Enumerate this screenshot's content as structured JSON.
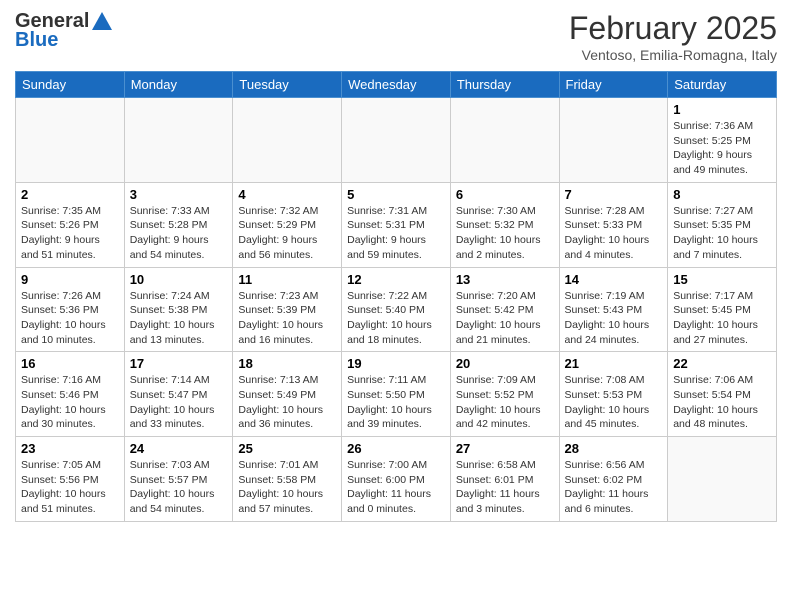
{
  "header": {
    "logo_general": "General",
    "logo_blue": "Blue",
    "month_title": "February 2025",
    "location": "Ventoso, Emilia-Romagna, Italy"
  },
  "days_of_week": [
    "Sunday",
    "Monday",
    "Tuesday",
    "Wednesday",
    "Thursday",
    "Friday",
    "Saturday"
  ],
  "weeks": [
    {
      "days": [
        {
          "num": "",
          "info": ""
        },
        {
          "num": "",
          "info": ""
        },
        {
          "num": "",
          "info": ""
        },
        {
          "num": "",
          "info": ""
        },
        {
          "num": "",
          "info": ""
        },
        {
          "num": "",
          "info": ""
        },
        {
          "num": "1",
          "info": "Sunrise: 7:36 AM\nSunset: 5:25 PM\nDaylight: 9 hours and 49 minutes."
        }
      ]
    },
    {
      "days": [
        {
          "num": "2",
          "info": "Sunrise: 7:35 AM\nSunset: 5:26 PM\nDaylight: 9 hours and 51 minutes."
        },
        {
          "num": "3",
          "info": "Sunrise: 7:33 AM\nSunset: 5:28 PM\nDaylight: 9 hours and 54 minutes."
        },
        {
          "num": "4",
          "info": "Sunrise: 7:32 AM\nSunset: 5:29 PM\nDaylight: 9 hours and 56 minutes."
        },
        {
          "num": "5",
          "info": "Sunrise: 7:31 AM\nSunset: 5:31 PM\nDaylight: 9 hours and 59 minutes."
        },
        {
          "num": "6",
          "info": "Sunrise: 7:30 AM\nSunset: 5:32 PM\nDaylight: 10 hours and 2 minutes."
        },
        {
          "num": "7",
          "info": "Sunrise: 7:28 AM\nSunset: 5:33 PM\nDaylight: 10 hours and 4 minutes."
        },
        {
          "num": "8",
          "info": "Sunrise: 7:27 AM\nSunset: 5:35 PM\nDaylight: 10 hours and 7 minutes."
        }
      ]
    },
    {
      "days": [
        {
          "num": "9",
          "info": "Sunrise: 7:26 AM\nSunset: 5:36 PM\nDaylight: 10 hours and 10 minutes."
        },
        {
          "num": "10",
          "info": "Sunrise: 7:24 AM\nSunset: 5:38 PM\nDaylight: 10 hours and 13 minutes."
        },
        {
          "num": "11",
          "info": "Sunrise: 7:23 AM\nSunset: 5:39 PM\nDaylight: 10 hours and 16 minutes."
        },
        {
          "num": "12",
          "info": "Sunrise: 7:22 AM\nSunset: 5:40 PM\nDaylight: 10 hours and 18 minutes."
        },
        {
          "num": "13",
          "info": "Sunrise: 7:20 AM\nSunset: 5:42 PM\nDaylight: 10 hours and 21 minutes."
        },
        {
          "num": "14",
          "info": "Sunrise: 7:19 AM\nSunset: 5:43 PM\nDaylight: 10 hours and 24 minutes."
        },
        {
          "num": "15",
          "info": "Sunrise: 7:17 AM\nSunset: 5:45 PM\nDaylight: 10 hours and 27 minutes."
        }
      ]
    },
    {
      "days": [
        {
          "num": "16",
          "info": "Sunrise: 7:16 AM\nSunset: 5:46 PM\nDaylight: 10 hours and 30 minutes."
        },
        {
          "num": "17",
          "info": "Sunrise: 7:14 AM\nSunset: 5:47 PM\nDaylight: 10 hours and 33 minutes."
        },
        {
          "num": "18",
          "info": "Sunrise: 7:13 AM\nSunset: 5:49 PM\nDaylight: 10 hours and 36 minutes."
        },
        {
          "num": "19",
          "info": "Sunrise: 7:11 AM\nSunset: 5:50 PM\nDaylight: 10 hours and 39 minutes."
        },
        {
          "num": "20",
          "info": "Sunrise: 7:09 AM\nSunset: 5:52 PM\nDaylight: 10 hours and 42 minutes."
        },
        {
          "num": "21",
          "info": "Sunrise: 7:08 AM\nSunset: 5:53 PM\nDaylight: 10 hours and 45 minutes."
        },
        {
          "num": "22",
          "info": "Sunrise: 7:06 AM\nSunset: 5:54 PM\nDaylight: 10 hours and 48 minutes."
        }
      ]
    },
    {
      "days": [
        {
          "num": "23",
          "info": "Sunrise: 7:05 AM\nSunset: 5:56 PM\nDaylight: 10 hours and 51 minutes."
        },
        {
          "num": "24",
          "info": "Sunrise: 7:03 AM\nSunset: 5:57 PM\nDaylight: 10 hours and 54 minutes."
        },
        {
          "num": "25",
          "info": "Sunrise: 7:01 AM\nSunset: 5:58 PM\nDaylight: 10 hours and 57 minutes."
        },
        {
          "num": "26",
          "info": "Sunrise: 7:00 AM\nSunset: 6:00 PM\nDaylight: 11 hours and 0 minutes."
        },
        {
          "num": "27",
          "info": "Sunrise: 6:58 AM\nSunset: 6:01 PM\nDaylight: 11 hours and 3 minutes."
        },
        {
          "num": "28",
          "info": "Sunrise: 6:56 AM\nSunset: 6:02 PM\nDaylight: 11 hours and 6 minutes."
        },
        {
          "num": "",
          "info": ""
        }
      ]
    }
  ]
}
